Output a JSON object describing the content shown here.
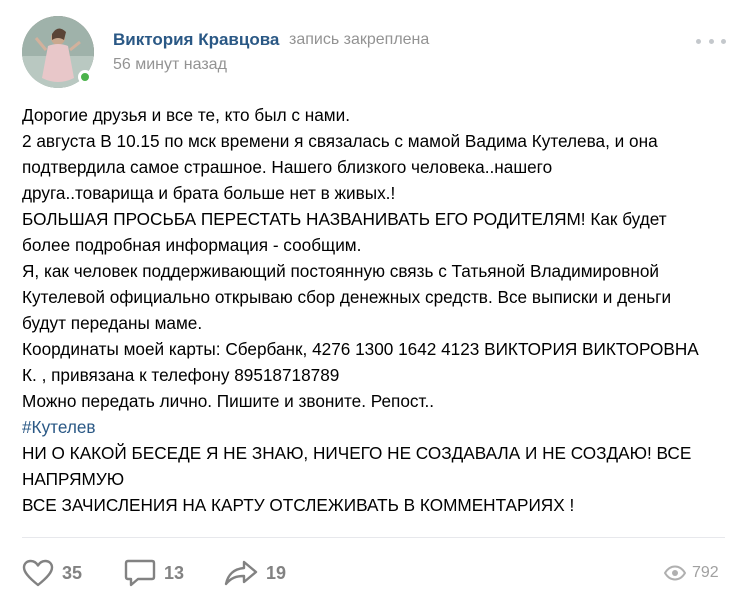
{
  "post": {
    "author": {
      "name": "Виктория Кравцова",
      "online": true
    },
    "pinned_label": "запись закреплена",
    "time": "56 минут назад",
    "text_lines": [
      "Дорогие друзья и все те, кто был с нами.",
      "2 августа В 10.15 по мск времени я связалась с мамой Вадима Кутелева, и она",
      "подтвердила самое страшное. Нашего близкого человека..нашего",
      "друга..товарища и брата больше нет в живых.!",
      "БОЛЬШАЯ ПРОСЬБА ПЕРЕСТАТЬ НАЗВАНИВАТЬ ЕГО РОДИТЕЛЯМ! Как будет",
      "более подробная информация - сообщим.",
      "Я, как человек поддерживающий постоянную связь с Татьяной Владимировной",
      "Кутелевой официально открываю сбор денежных средств. Все выписки и деньги",
      "будут переданы маме.",
      "Координаты моей карты: Сбербанк, 4276 1300 1642 4123 ВИКТОРИЯ ВИКТОРОВНА",
      "К. , привязана к телефону 89518718789",
      "Можно передать лично. Пишите и звоните. Репост..",
      "#Кутелев",
      "НИ О КАКОЙ БЕСЕДЕ Я НЕ ЗНАЮ, НИЧЕГО НЕ СОЗДАВАЛА И НЕ СОЗДАЮ! ВСЕ",
      "НАПРЯМУЮ",
      "ВСЕ ЗАЧИСЛЕНИЯ НА КАРТУ ОТСЛЕЖИВАТЬ В КОММЕНТАРИЯХ !"
    ],
    "footer": {
      "likes": "35",
      "comments": "13",
      "shares": "19",
      "views": "792"
    }
  },
  "icons": {
    "like": "heart-icon",
    "comment": "comment-bubble-icon",
    "share": "share-arrow-icon",
    "views": "eye-icon",
    "more": "more-dots-icon"
  },
  "colors": {
    "link": "#2a5885",
    "secondary_text": "#939393",
    "icon_gray": "#828282",
    "online": "#4bb34b"
  }
}
